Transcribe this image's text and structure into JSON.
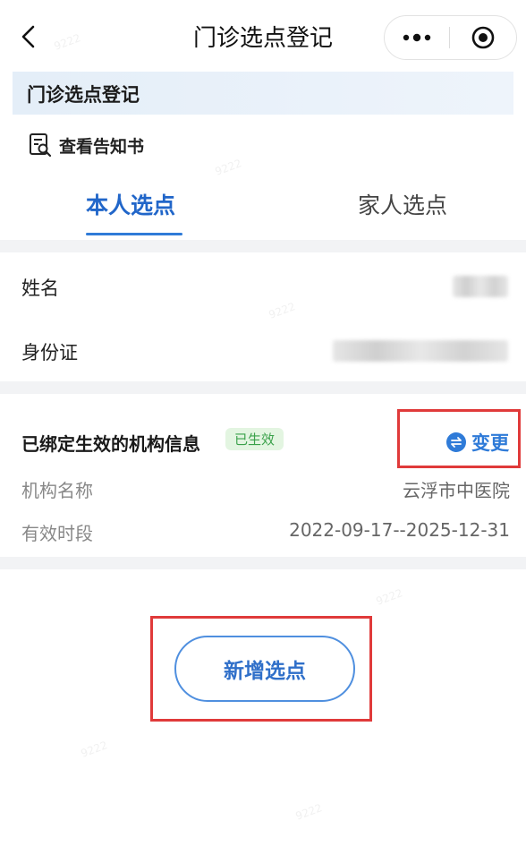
{
  "header": {
    "title": "门诊选点登记",
    "back_icon": "chevron-left-icon",
    "more_icon": "more-dots-icon",
    "target_icon": "target-icon"
  },
  "banner": {
    "title": "门诊选点登记"
  },
  "notice": {
    "label": "查看告知书",
    "icon": "document-search-icon"
  },
  "tabs": [
    {
      "label": "本人选点",
      "active": true
    },
    {
      "label": "家人选点",
      "active": false
    }
  ],
  "personal": {
    "name_label": "姓名",
    "id_label": "身份证"
  },
  "institution": {
    "section_title": "已绑定生效的机构信息",
    "status_badge": "已生效",
    "change_label": "变更",
    "change_icon": "swap-icon",
    "rows": [
      {
        "label": "机构名称",
        "value": "云浮市中医院"
      },
      {
        "label": "有效时段",
        "value": "2022-09-17--2025-12-31"
      }
    ]
  },
  "actions": {
    "add_label": "新增选点"
  },
  "colors": {
    "accent": "#2f7bd8",
    "highlight_box": "#e03a3a",
    "badge_bg": "#e3f5e1",
    "badge_text": "#3aa14a"
  }
}
